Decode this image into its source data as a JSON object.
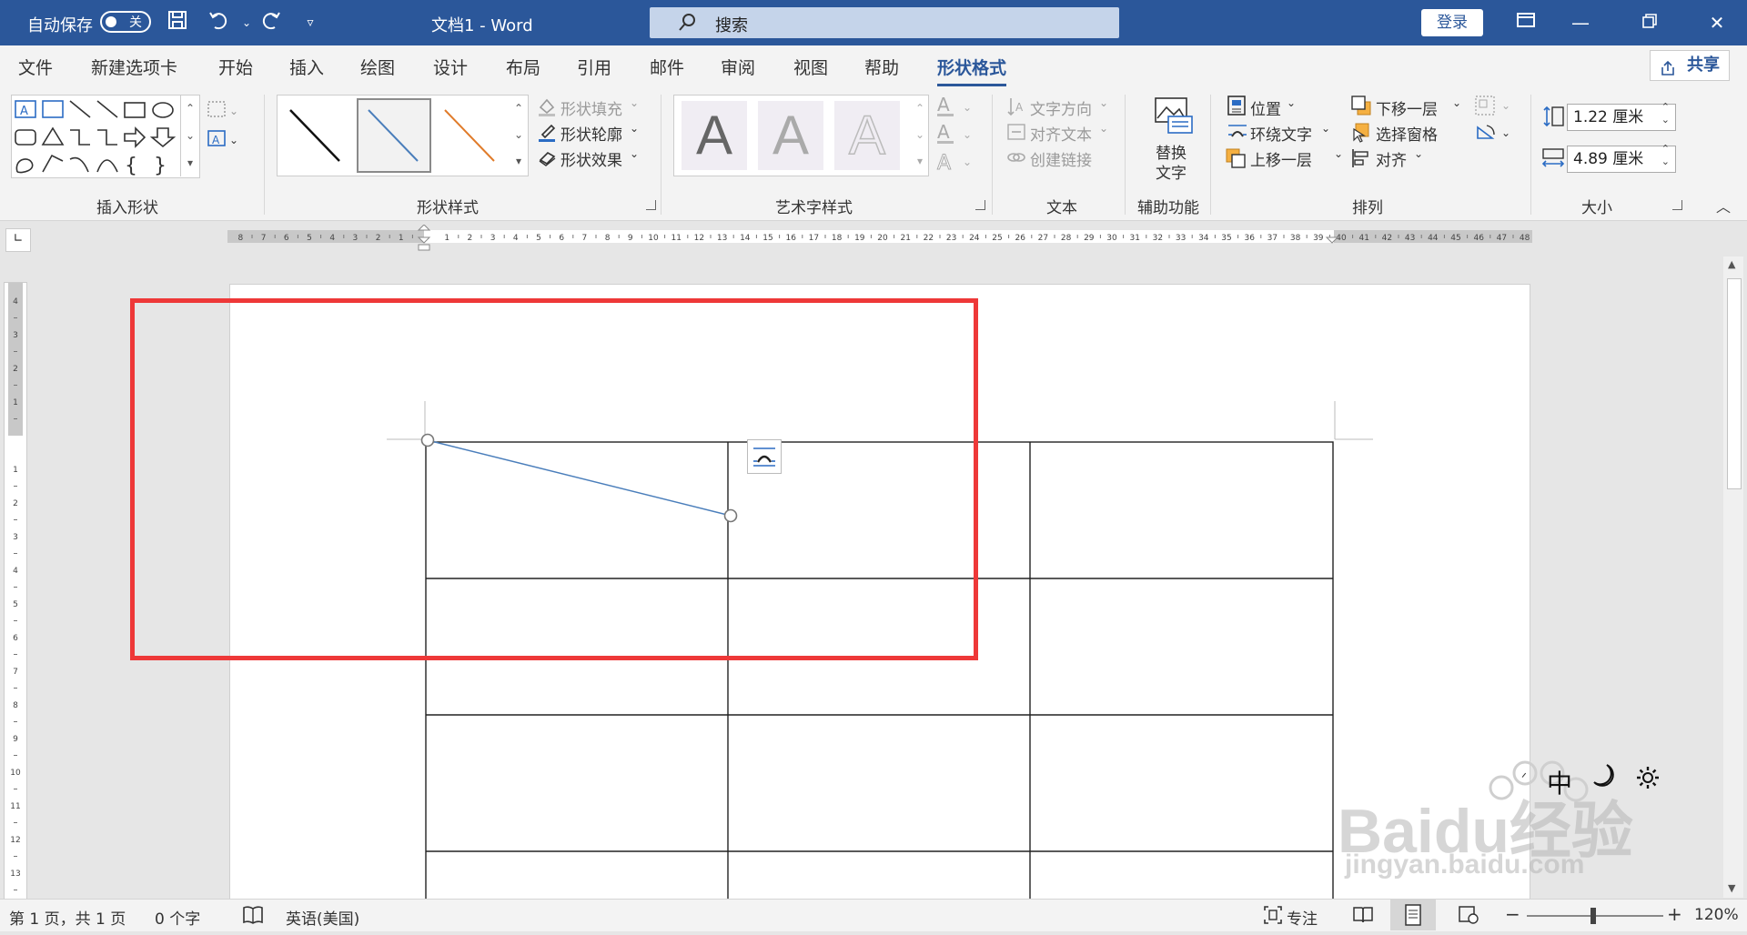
{
  "titlebar": {
    "autosave_label": "自动保存",
    "autosave_state": "关",
    "doc_title": "文档1 - Word",
    "search_placeholder": "搜索",
    "login_label": "登录"
  },
  "tabs": [
    "文件",
    "新建选项卡",
    "开始",
    "插入",
    "绘图",
    "设计",
    "布局",
    "引用",
    "邮件",
    "审阅",
    "视图",
    "帮助",
    "形状格式"
  ],
  "active_tab": "形状格式",
  "share_label": "共享",
  "ribbon": {
    "groups": {
      "insert_shapes": "插入形状",
      "shape_styles": "形状样式",
      "wordart_styles": "艺术字样式",
      "text": "文本",
      "accessibility": "辅助功能",
      "arrange": "排列",
      "size": "大小"
    },
    "shape_fill": "形状填充",
    "shape_outline": "形状轮廓",
    "shape_effects": "形状效果",
    "text_direction": "文字方向",
    "align_text": "对齐文本",
    "create_link": "创建链接",
    "alt_text_line1": "替换",
    "alt_text_line2": "文字",
    "position": "位置",
    "wrap_text": "环绕文字",
    "bring_forward": "上移一层",
    "send_backward": "下移一层",
    "selection_pane": "选择窗格",
    "align": "对齐",
    "height_value": "1.22 厘米",
    "width_value": "4.89 厘米",
    "wordart_letter": "A"
  },
  "status": {
    "page_info": "第 1 页，共 1 页",
    "word_count": "0 个字",
    "language": "英语(美国)",
    "focus": "专注",
    "zoom": "120%"
  },
  "ime": {
    "mode": "中"
  },
  "watermark": {
    "brand": "Baidu经验",
    "url": "jingyan.baidu.com"
  },
  "colors": {
    "title_blue": "#2b579a",
    "highlight_red": "#ee3838",
    "line_blue": "#4a7ebb",
    "line_orange": "#e07b2a"
  }
}
